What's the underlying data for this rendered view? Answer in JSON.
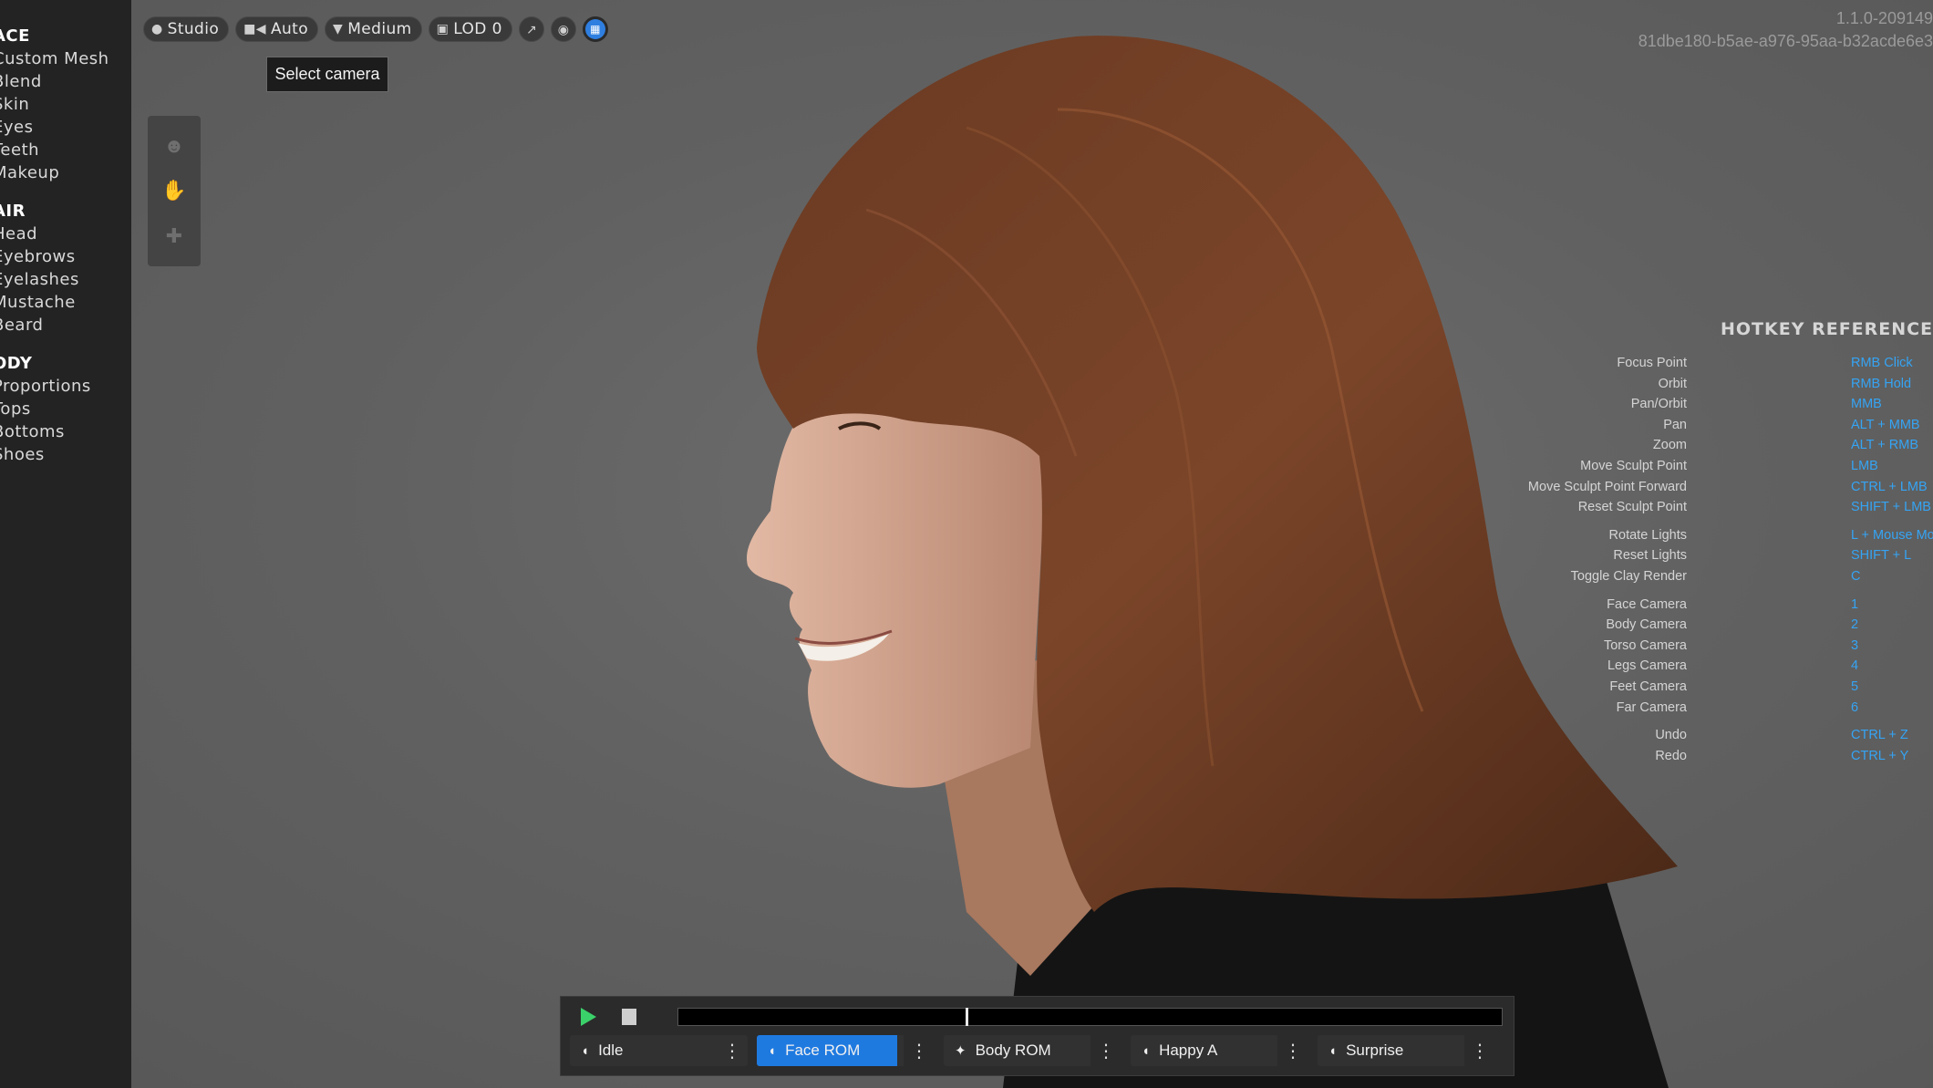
{
  "sidebar": {
    "sections": [
      {
        "title": "ACE",
        "items": [
          "Custom Mesh",
          "Blend",
          "Skin",
          "Eyes",
          "Teeth",
          "Makeup"
        ]
      },
      {
        "title": "AIR",
        "items": [
          "Head",
          "Eyebrows",
          "Eyelashes",
          "Mustache",
          "Beard"
        ]
      },
      {
        "title": "ODY",
        "items": [
          "Proportions",
          "Tops",
          "Bottoms",
          "Shoes"
        ]
      }
    ]
  },
  "toolbar": {
    "lighting_label": "Studio",
    "camera_label": "Auto",
    "quality_label": "Medium",
    "lod_label": "LOD 0",
    "tooltip": "Select camera",
    "active_toggle_color": "#2f7fe0"
  },
  "version": {
    "number": "1.1.0-209149",
    "id": "81dbe180-b5ae-a976-95aa-b32acde6e3"
  },
  "hotkeys": {
    "title": "HOTKEY REFERENCE",
    "key_color": "#35a4f4",
    "rows": [
      {
        "action": "Focus Point",
        "key": "RMB Click"
      },
      {
        "action": "Orbit",
        "key": "RMB Hold"
      },
      {
        "action": "Pan/Orbit",
        "key": "MMB"
      },
      {
        "action": "Pan",
        "key": "ALT + MMB"
      },
      {
        "action": "Zoom",
        "key": "ALT + RMB"
      },
      {
        "action": "Move Sculpt Point",
        "key": "LMB"
      },
      {
        "action": "Move Sculpt Point Forward",
        "key": "CTRL + LMB"
      },
      {
        "action": "Reset Sculpt Point",
        "key": "SHIFT + LMB"
      },
      {
        "action": "Rotate Lights",
        "key": "L + Mouse Mo"
      },
      {
        "action": "Reset Lights",
        "key": "SHIFT + L"
      },
      {
        "action": "Toggle Clay Render",
        "key": "C"
      },
      {
        "action": "Face Camera",
        "key": "1"
      },
      {
        "action": "Body Camera",
        "key": "2"
      },
      {
        "action": "Torso Camera",
        "key": "3"
      },
      {
        "action": "Legs Camera",
        "key": "4"
      },
      {
        "action": "Feet Camera",
        "key": "5"
      },
      {
        "action": "Far Camera",
        "key": "6"
      },
      {
        "action": "Undo",
        "key": "CTRL + Z"
      },
      {
        "action": "Redo",
        "key": "CTRL + Y"
      }
    ]
  },
  "player": {
    "progress": 0.35,
    "play_color": "#3bd16a",
    "animations": [
      {
        "label": "Idle",
        "icon": "face-icon",
        "selected": false
      },
      {
        "label": "Face ROM",
        "icon": "face-icon",
        "selected": true
      },
      {
        "label": "Body ROM",
        "icon": "body-icon",
        "selected": false
      },
      {
        "label": "Happy A",
        "icon": "face-icon",
        "selected": false
      },
      {
        "label": "Surprise",
        "icon": "face-icon",
        "selected": false
      }
    ]
  }
}
